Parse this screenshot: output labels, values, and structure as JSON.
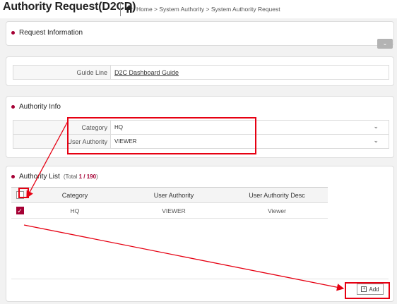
{
  "header": {
    "title": "Authority Request(D2CD)",
    "breadcrumb": "Home > System Authority > System Authority Request"
  },
  "request_info": {
    "section_title": "Request Information",
    "guide_label": "Guide Line",
    "guide_link": "D2C Dashboard Guide"
  },
  "authority_info": {
    "section_title": "Authority Info",
    "category_label": "Category",
    "category_value": "HQ",
    "user_authority_label": "User Authority",
    "user_authority_value": "VIEWER"
  },
  "authority_list": {
    "section_title": "Authority List",
    "total_prefix": "(Total ",
    "total_count": "1 / 190",
    "total_suffix": ")",
    "columns": [
      "Category",
      "User Authority",
      "User Authority Desc"
    ],
    "rows": [
      {
        "checked": true,
        "category": "HQ",
        "user_authority": "VIEWER",
        "desc": "Viewer"
      }
    ],
    "add_label": "Add"
  },
  "colors": {
    "accent": "#a50034",
    "annotation_red": "#e60012"
  }
}
